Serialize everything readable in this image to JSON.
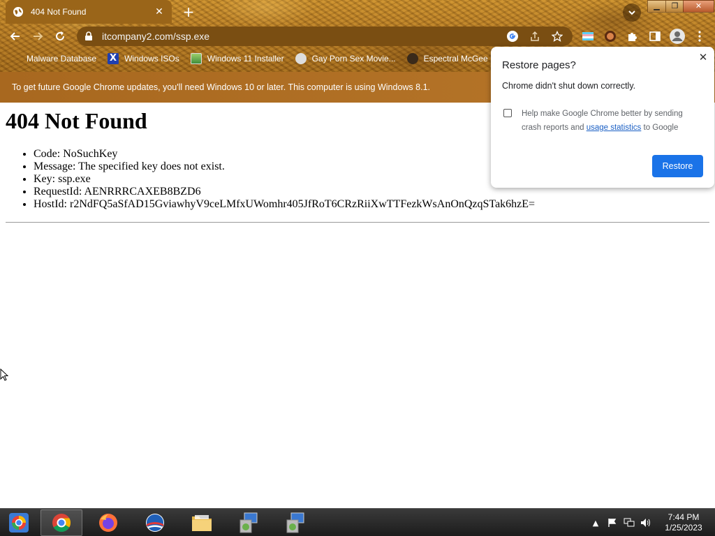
{
  "browser": {
    "tab_title": "404 Not Found",
    "url": "itcompany2.com/ssp.exe",
    "bookmarks": [
      {
        "label": "Malware Database",
        "icon": "folder-icon"
      },
      {
        "label": "Windows ISOs",
        "icon": "x-icon"
      },
      {
        "label": "Windows 11 Installer",
        "icon": "image-icon"
      },
      {
        "label": "Gay Porn Sex Movie...",
        "icon": "site-icon"
      },
      {
        "label": "Espectral McGee",
        "icon": "character-icon"
      }
    ],
    "infobar_text": "To get future Google Chrome updates, you'll need Windows 10 or later. This computer is using Windows 8.1."
  },
  "page": {
    "heading": "404 Not Found",
    "items": [
      "Code: NoSuchKey",
      "Message: The specified key does not exist.",
      "Key: ssp.exe",
      "RequestId: AENRRRCAXEB8BZD6",
      "HostId: r2NdFQ5aSfAD15GviawhyV9ceLMfxUWomhr405JfRoT6CRzRiiXwTTFezkWsAnOnQzqSTak6hzE="
    ]
  },
  "popup": {
    "title": "Restore pages?",
    "message": "Chrome didn't shut down correctly.",
    "help_prefix": "Help make Google Chrome better by sending crash reports and ",
    "help_link": "usage statistics",
    "help_suffix": " to Google",
    "restore_label": "Restore"
  },
  "taskbar": {
    "time": "7:44 PM",
    "date": "1/25/2023"
  },
  "colors": {
    "restore_button": "#1a73e8",
    "link": "#1a5fc4",
    "theme": "#b27722"
  }
}
